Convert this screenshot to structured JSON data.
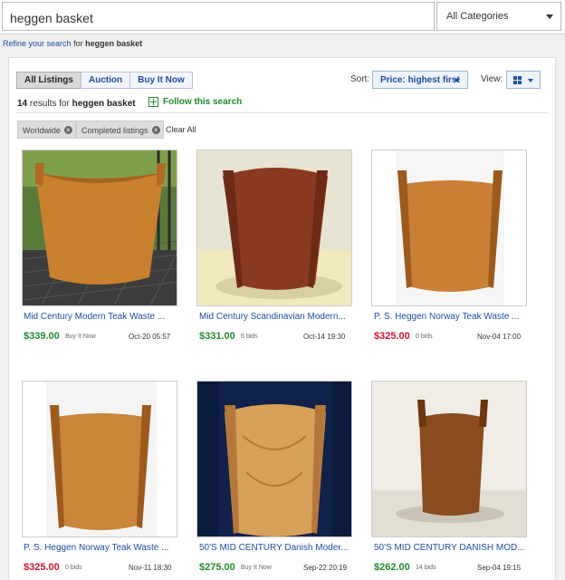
{
  "search": {
    "query": "heggen basket",
    "category": "All Categories"
  },
  "refine": {
    "link": "Refine your search",
    "for": "for",
    "term": "heggen basket"
  },
  "tabs": [
    "All Listings",
    "Auction",
    "Buy It Now"
  ],
  "sort": {
    "label": "Sort:",
    "value": "Price: highest first"
  },
  "view": {
    "label": "View:"
  },
  "results": {
    "count": "14",
    "text": "results for",
    "term": "heggen basket"
  },
  "follow": "Follow this search",
  "filters": [
    "Worldwide",
    "Completed listings"
  ],
  "clear_all": "Clear All",
  "listings": [
    {
      "title": "Mid Century Modern Teak Waste ...",
      "price": "$339.00",
      "price_color": "#1f8c2e",
      "format": "Buy It Now",
      "date": "Oct-20 05:57"
    },
    {
      "title": "Mid Century Scandinavian Modern...",
      "price": "$331.00",
      "price_color": "#1f8c2e",
      "format": "6 bids",
      "date": "Oct-14 19:30"
    },
    {
      "title": "P. S. Heggen Norway Teak Waste ...",
      "price": "$325.00",
      "price_color": "#d0122f",
      "format": "0 bids",
      "date": "Nov-04 17:00"
    },
    {
      "title": "P. S. Heggen Norway Teak Waste ...",
      "price": "$325.00",
      "price_color": "#d0122f",
      "format": "0 bids",
      "date": "Nov-11 18:30"
    },
    {
      "title": "50'S MID CENTURY Danish Moder...",
      "price": "$275.00",
      "price_color": "#1f8c2e",
      "format": "Buy It Now",
      "date": "Sep-22 20:19"
    },
    {
      "title": "50'S MID CENTURY DANISH MOD...",
      "price": "$262.00",
      "price_color": "#1f8c2e",
      "format": "14 bids",
      "date": "Sep-04 19:15"
    }
  ]
}
